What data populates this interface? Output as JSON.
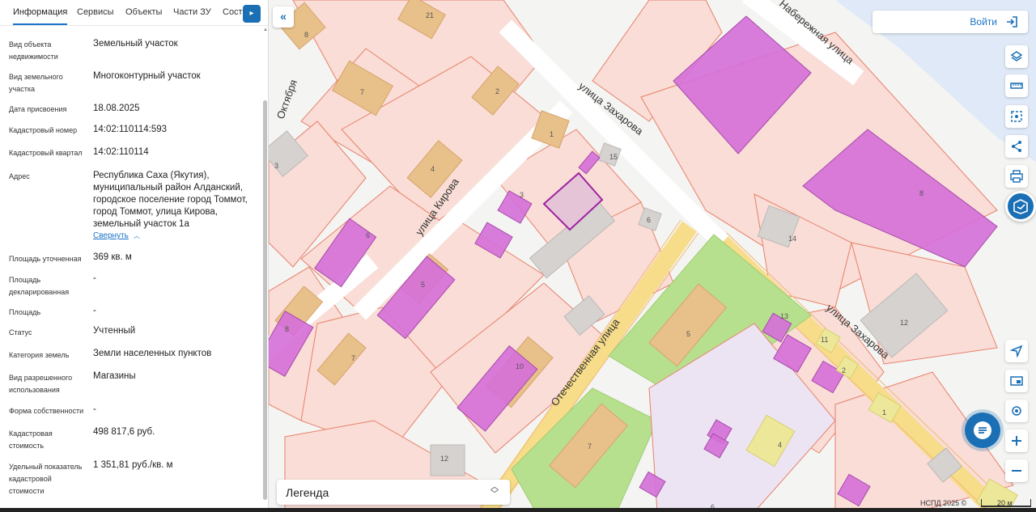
{
  "tabs": [
    {
      "label": "Информация",
      "active": true
    },
    {
      "label": "Сервисы",
      "active": false
    },
    {
      "label": "Объекты",
      "active": false
    },
    {
      "label": "Части ЗУ",
      "active": false
    },
    {
      "label": "Соста",
      "active": false
    }
  ],
  "properties": [
    {
      "label": "Вид объекта недвижимости",
      "value": "Земельный участок"
    },
    {
      "label": "Вид земельного участка",
      "value": "Многоконтурный участок"
    },
    {
      "label": "Дата присвоения",
      "value": "18.08.2025"
    },
    {
      "label": "Кадастровый номер",
      "value": "14:02:110114:593"
    },
    {
      "label": "Кадастровый квартал",
      "value": "14:02:110114"
    },
    {
      "label": "Адрес",
      "value": "Республика Саха (Якутия), муниципальный район Алданский, городское поселение город Томмот, город Томмот, улица Кирова, земельный участок 1а"
    },
    {
      "label": "Площадь уточненная",
      "value": "369 кв. м"
    },
    {
      "label": "Площадь декларированная",
      "value": "-"
    },
    {
      "label": "Площадь",
      "value": "-"
    },
    {
      "label": "Статус",
      "value": "Учтенный"
    },
    {
      "label": "Категория земель",
      "value": "Земли населенных пунктов"
    },
    {
      "label": "Вид разрешенного использования",
      "value": "Магазины"
    },
    {
      "label": "Форма собственности",
      "value": "-"
    },
    {
      "label": "Кадастровая стоимость",
      "value": "498 817,6 руб."
    },
    {
      "label": "Удельный показатель кадастровой стоимости",
      "value": "1 351,81 руб./кв. м"
    }
  ],
  "collapse_label": "Свернуть",
  "map": {
    "streets": [
      "улица Захарова",
      "улица Кирова",
      "Отечественная улица",
      "улица Захарова",
      "Набережная улица",
      "Октября"
    ],
    "parcel_numbers": [
      "21",
      "8",
      "7",
      "2",
      "1",
      "4",
      "3",
      "15",
      "3",
      "6",
      "6",
      "5",
      "8",
      "7",
      "10",
      "14",
      "8",
      "5",
      "13",
      "11",
      "2",
      "12",
      "7",
      "12",
      "4",
      "1",
      "6"
    ]
  },
  "login_label": "Войти",
  "legend_label": "Легенда",
  "copyright": "НСПД 2025 ©",
  "scale_label": "20 м",
  "icons": {
    "collapse": "double-chevron-left-icon",
    "login": "login-arrow-icon",
    "tools": [
      "layers-icon",
      "ruler-icon",
      "area-select-icon",
      "share-icon",
      "print-icon",
      "map-service-icon",
      "navigation-icon",
      "minimap-icon",
      "location-icon",
      "zoom-in-icon",
      "zoom-out-icon"
    ],
    "chat": "chat-icon"
  },
  "colors": {
    "accent": "#1a6fb5",
    "link": "#1a73c8",
    "parcel_border": "#e8806a",
    "parcel_fill": "#f9ddd6",
    "building": "#e8c08a",
    "selected": "#d56fd8",
    "green": "#b7e08e",
    "road": "#f7dc8a",
    "water": "#dfe9f7"
  }
}
